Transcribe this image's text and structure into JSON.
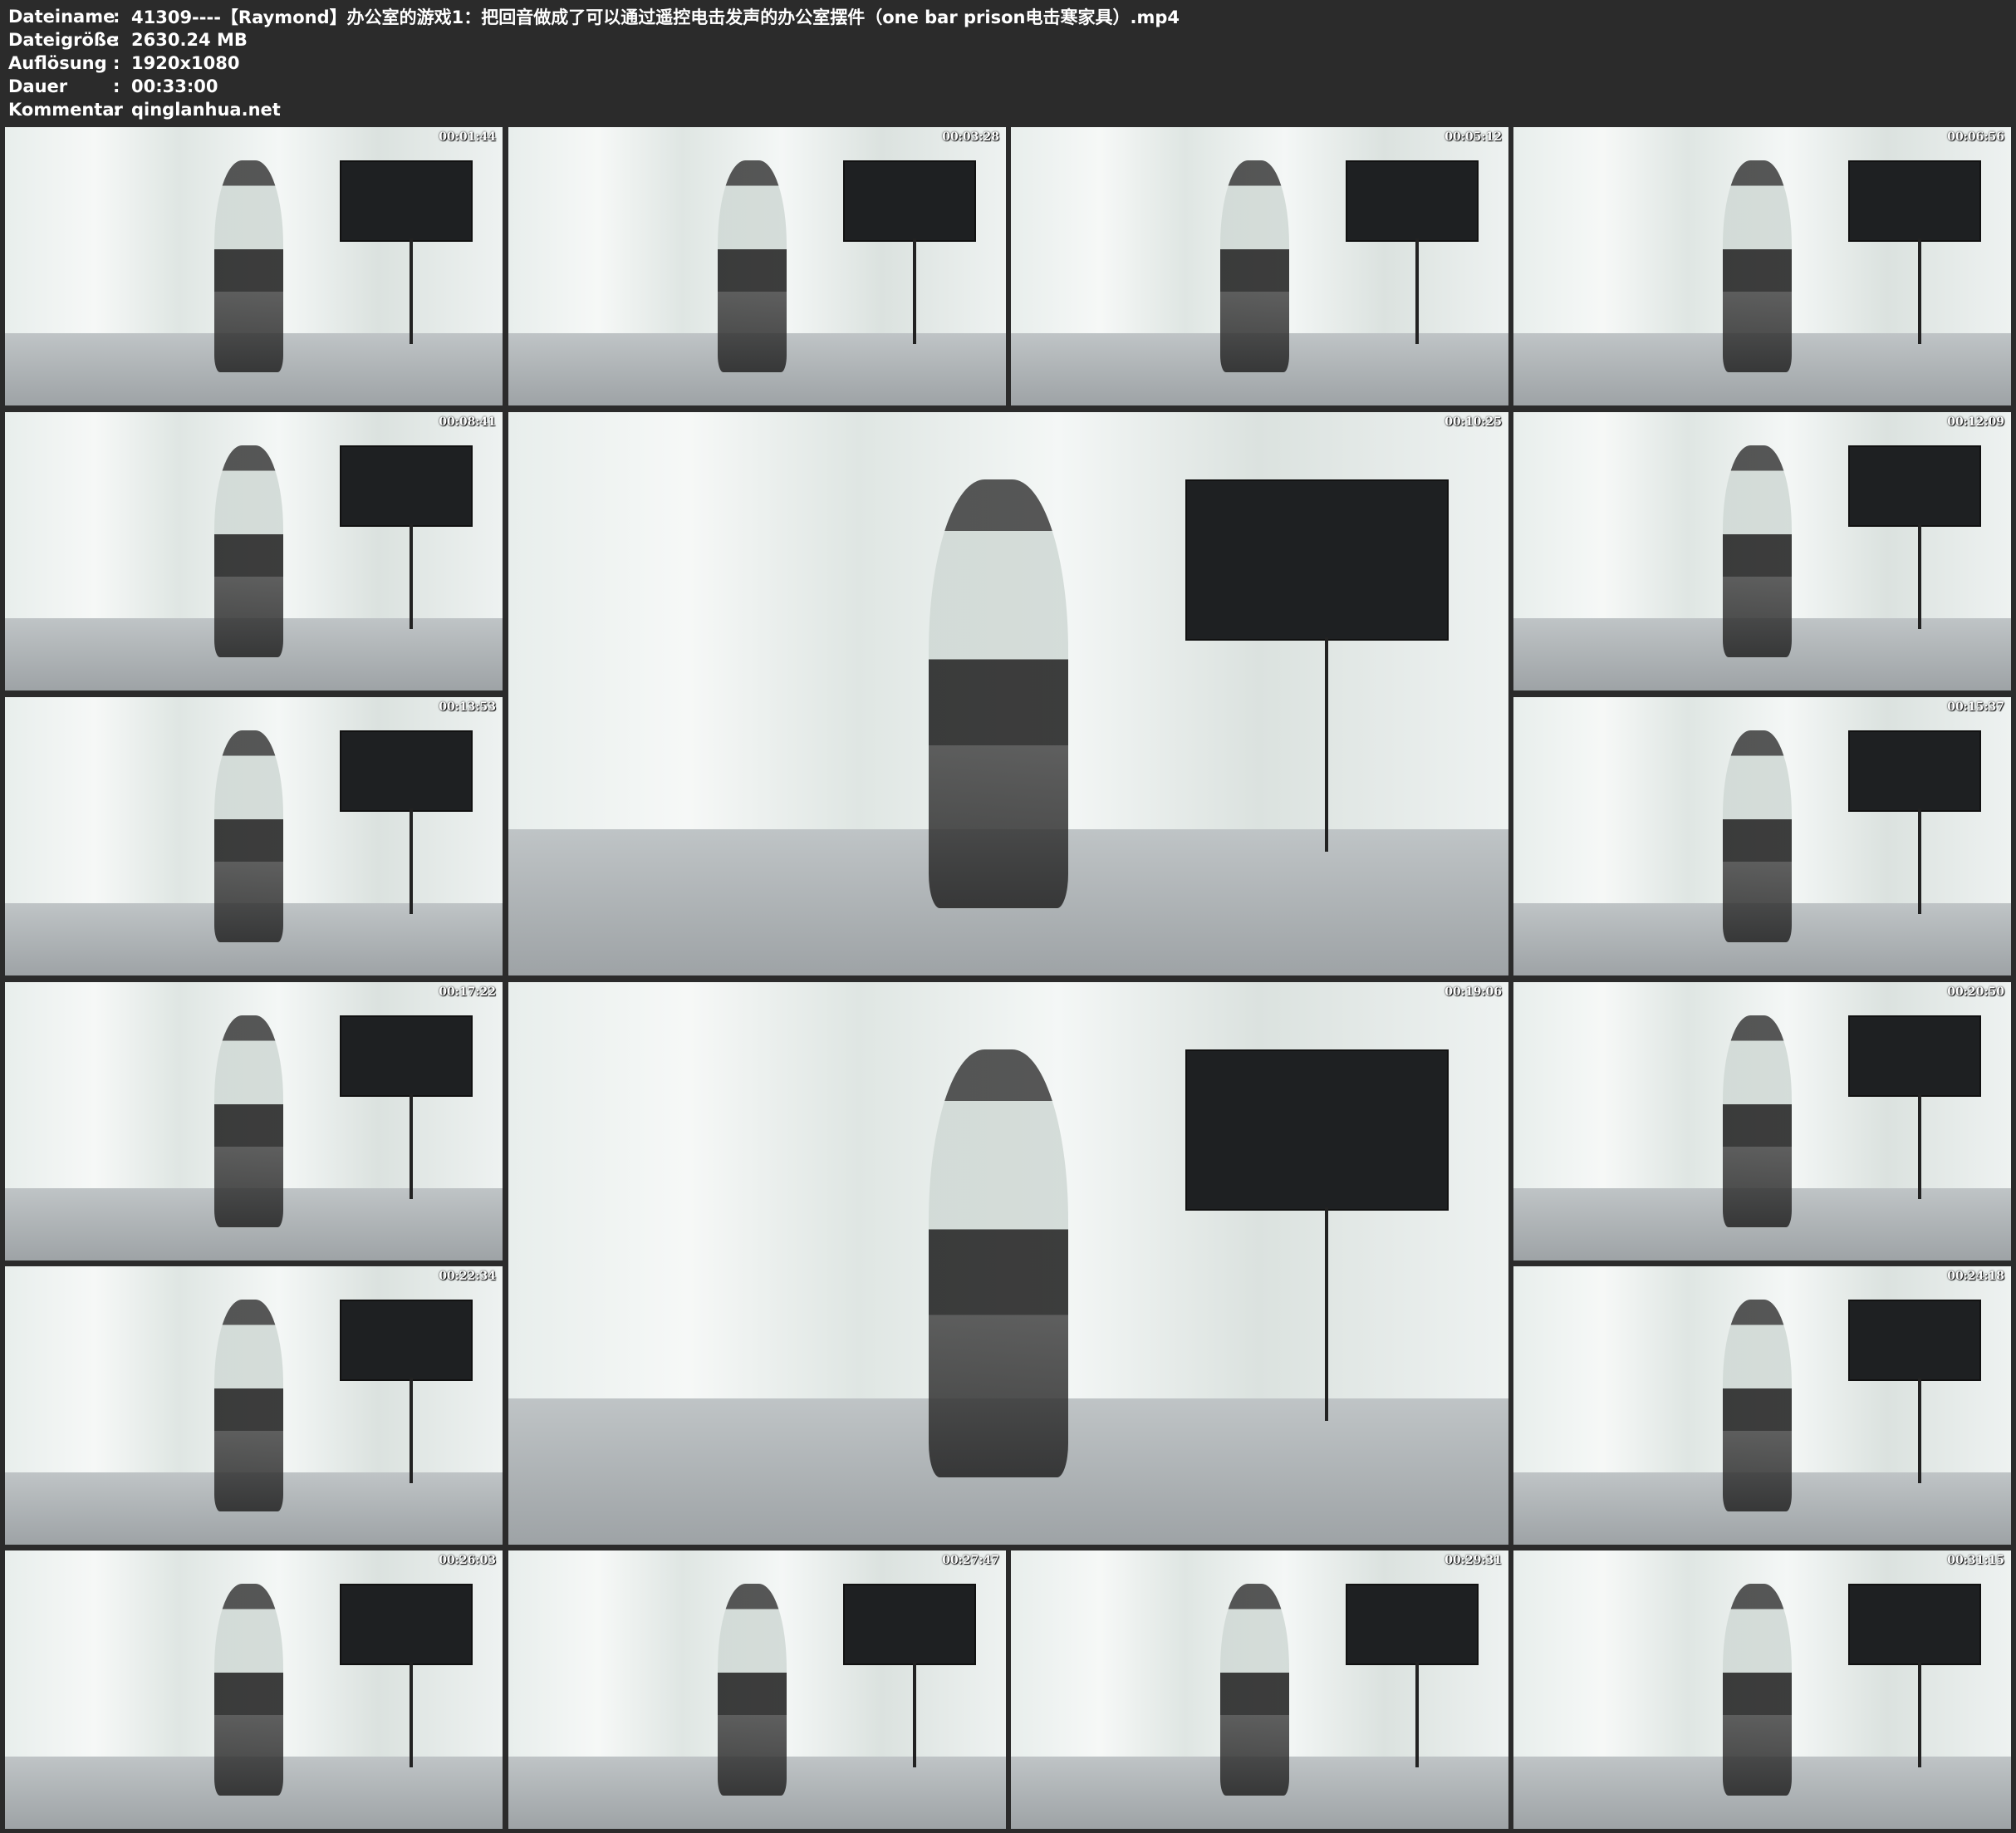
{
  "header": {
    "rows": [
      {
        "key": "Dateiname",
        "sep": ":",
        "value": "41309----【Raymond】办公室的游戏1：把回音做成了可以通过遥控电击发声的办公室摆件（one bar prison电击寒家具）.mp4"
      },
      {
        "key": "Dateigröße",
        "sep": ":",
        "value": "2630.24 MB"
      },
      {
        "key": "Auflösung",
        "sep": ":",
        "value": "1920x1080"
      },
      {
        "key": "Dauer",
        "sep": ":",
        "value": "00:33:00"
      },
      {
        "key": "Kommentar",
        "sep": ":",
        "value": "qinglanhua.net"
      }
    ]
  },
  "thumbnails": [
    {
      "timestamp": "00:01:44"
    },
    {
      "timestamp": "00:03:28"
    },
    {
      "timestamp": "00:05:12"
    },
    {
      "timestamp": "00:06:56"
    },
    {
      "timestamp": "00:08:41"
    },
    {
      "timestamp": "00:10:25"
    },
    {
      "timestamp": "00:12:09"
    },
    {
      "timestamp": "00:13:53"
    },
    {
      "timestamp": "00:15:37"
    },
    {
      "timestamp": "00:17:22"
    },
    {
      "timestamp": "00:19:06"
    },
    {
      "timestamp": "00:20:50"
    },
    {
      "timestamp": "00:22:34"
    },
    {
      "timestamp": "00:24:18"
    },
    {
      "timestamp": "00:26:03"
    },
    {
      "timestamp": "00:27:47"
    },
    {
      "timestamp": "00:29:31"
    },
    {
      "timestamp": "00:31:15"
    }
  ]
}
